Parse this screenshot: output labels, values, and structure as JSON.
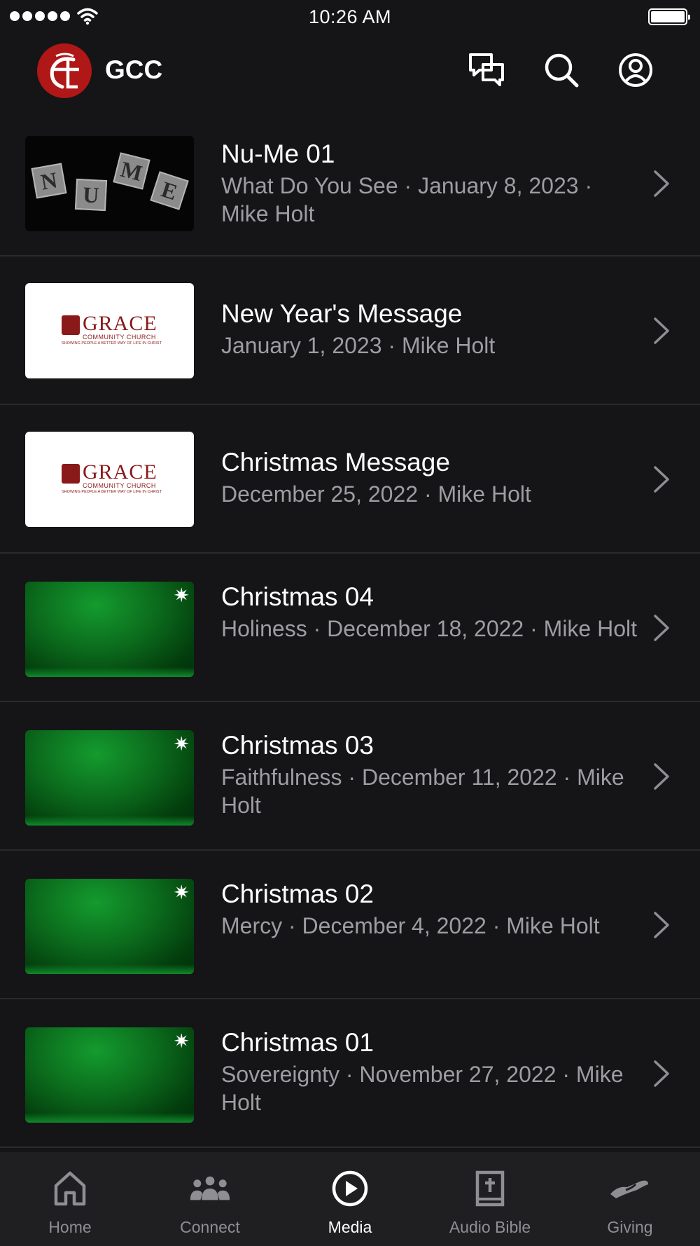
{
  "status_bar": {
    "time": "10:26 AM",
    "signal_icon": "signal-dots-icon",
    "wifi_icon": "wifi-icon",
    "battery_icon": "battery-icon"
  },
  "header": {
    "app_title": "GCC",
    "logo_icon": "gcc-logo-icon",
    "actions": [
      "chat-icon",
      "search-icon",
      "account-icon"
    ]
  },
  "media_items": [
    {
      "title": "Nu-Me 01",
      "subtitle": "What Do You See · January 8, 2023 · Mike Holt",
      "thumbnail": "nume-blocks",
      "blocks": [
        "N",
        "U",
        "M",
        "E"
      ]
    },
    {
      "title": "New Year's Message",
      "subtitle": "January 1, 2023 · Mike Holt",
      "thumbnail": "grace-logo"
    },
    {
      "title": "Christmas Message",
      "subtitle": "December 25, 2022 · Mike Holt",
      "thumbnail": "grace-logo"
    },
    {
      "title": "Christmas 04",
      "subtitle": "Holiness · December 18, 2022 · Mike Holt",
      "thumbnail": "green-star"
    },
    {
      "title": "Christmas 03",
      "subtitle": "Faithfulness · December 11, 2022 · Mike Holt",
      "thumbnail": "green-star"
    },
    {
      "title": "Christmas 02",
      "subtitle": "Mercy · December 4, 2022 · Mike Holt",
      "thumbnail": "green-star"
    },
    {
      "title": "Christmas 01",
      "subtitle": "Sovereignty · November 27, 2022 · Mike Holt",
      "thumbnail": "green-star"
    }
  ],
  "grace_logo": {
    "word": "GRACE",
    "sub": "COMMUNITY CHURCH",
    "tagline": "SHOWING PEOPLE A BETTER WAY OF LIFE IN CHRIST"
  },
  "tabs": [
    {
      "label": "Home",
      "icon": "home-icon",
      "active": false
    },
    {
      "label": "Connect",
      "icon": "people-icon",
      "active": false
    },
    {
      "label": "Media",
      "icon": "play-circle-icon",
      "active": true
    },
    {
      "label": "Audio Bible",
      "icon": "bible-icon",
      "active": false
    },
    {
      "label": "Giving",
      "icon": "giving-hand-icon",
      "active": false
    }
  ],
  "colors": {
    "background": "#151517",
    "tab_bar": "#1f1f22",
    "secondary_text": "#9d9da2",
    "inactive_tab": "#8e8e93",
    "brand_red": "#b01717"
  }
}
